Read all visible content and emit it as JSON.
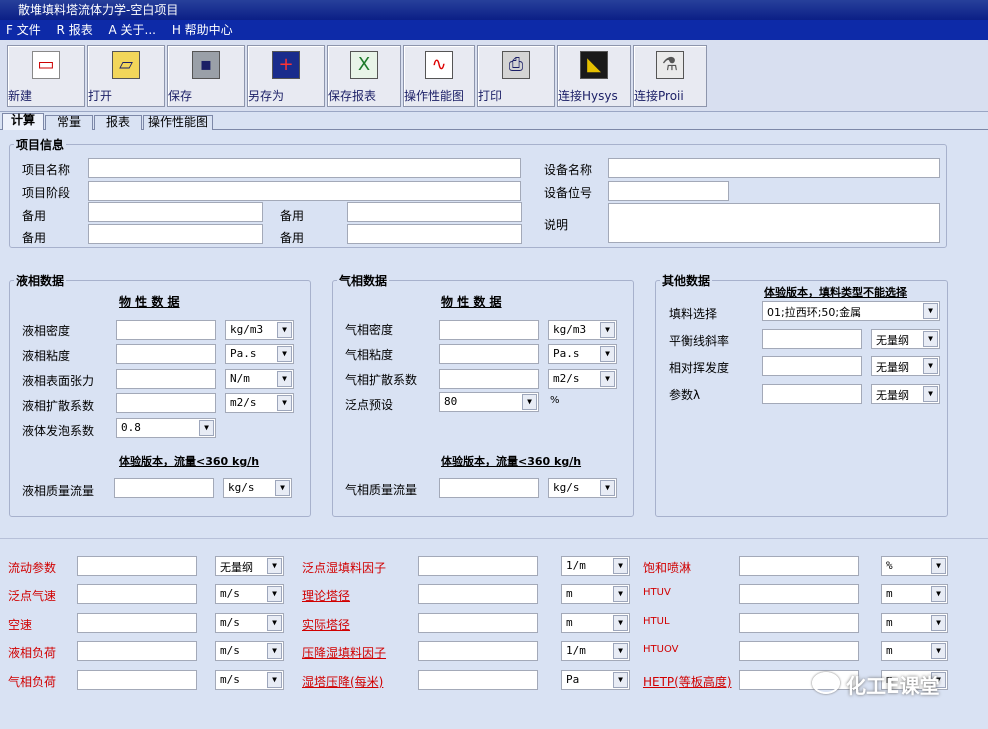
{
  "window": {
    "title": "散堆填料塔流体力学-空白项目"
  },
  "menu": [
    "F 文件",
    "R 报表",
    "A 关于...",
    "H 帮助中心"
  ],
  "toolbar": [
    "新建",
    "打开",
    "保存",
    "另存为",
    "保存报表",
    "操作性能图",
    "打印",
    "连接Hysys",
    "连接Proii"
  ],
  "tabs": [
    "计算",
    "常量",
    "报表",
    "操作性能图"
  ],
  "project": {
    "title": "项目信息",
    "name_label": "项目名称",
    "stage_label": "项目阶段",
    "spare1": "备用",
    "spare2": "备用",
    "spare3": "备用",
    "spare4": "备用",
    "equip_name_label": "设备名称",
    "equip_tag_label": "设备位号",
    "desc_label": "说明"
  },
  "liquid": {
    "title": "液相数据",
    "props_header": "物 性 数 据",
    "density": "液相密度",
    "density_unit": "kg/m3",
    "viscosity": "液相粘度",
    "viscosity_unit": "Pa.s",
    "tension": "液相表面张力",
    "tension_unit": "N/m",
    "diffusion": "液相扩散系数",
    "diffusion_unit": "m2/s",
    "foam": "液体发泡系数",
    "foam_value": "0.8",
    "trial_note": "体验版本，流量<360 kg/h",
    "flow": "液相质量流量",
    "flow_unit": "kg/s"
  },
  "gas": {
    "title": "气相数据",
    "props_header": "物 性 数 据",
    "density": "气相密度",
    "density_unit": "kg/m3",
    "viscosity": "气相粘度",
    "viscosity_unit": "Pa.s",
    "diffusion": "气相扩散系数",
    "diffusion_unit": "m2/s",
    "flood": "泛点预设",
    "flood_value": "80",
    "flood_unit": "%",
    "trial_note": "体验版本，流量<360 kg/h",
    "flow": "气相质量流量",
    "flow_unit": "kg/s"
  },
  "other": {
    "title": "其他数据",
    "trial_note": "体验版本，填料类型不能选择",
    "packing": "填料选择",
    "packing_value": "01;拉西环;50;金属",
    "slope": "平衡线斜率",
    "slope_unit": "无量纲",
    "volatility": "相对挥发度",
    "volatility_unit": "无量纲",
    "param": "参数λ",
    "param_unit": "无量纲"
  },
  "results": {
    "col1": [
      {
        "label": "流动参数",
        "unit": "无量纲"
      },
      {
        "label": "泛点气速",
        "unit": "m/s"
      },
      {
        "label": "空速",
        "unit": "m/s"
      },
      {
        "label": "液相负荷",
        "unit": "m/s"
      },
      {
        "label": "气相负荷",
        "unit": "m/s"
      }
    ],
    "col2": [
      {
        "label": "泛点湿填料因子",
        "unit": "1/m"
      },
      {
        "label": "理论塔径",
        "unit": "m"
      },
      {
        "label": "实际塔径",
        "unit": "m"
      },
      {
        "label": "压降湿填料因子",
        "unit": "1/m"
      },
      {
        "label": "湿塔压降(每米)",
        "unit": "Pa"
      }
    ],
    "col3": [
      {
        "label": "饱和喷淋",
        "unit": "%"
      },
      {
        "label": "HTUV",
        "unit": "m"
      },
      {
        "label": "HTUL",
        "unit": "m"
      },
      {
        "label": "HTUOV",
        "unit": "m"
      },
      {
        "label": "HETP(等板高度)",
        "unit": "m"
      }
    ]
  },
  "watermark": "化工E课堂"
}
